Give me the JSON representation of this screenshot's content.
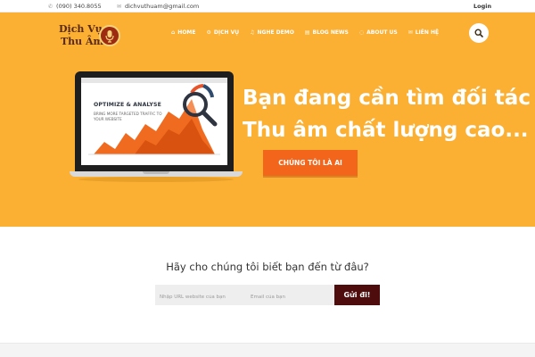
{
  "topbar": {
    "phone": "(090) 340.8055",
    "email": "dichvuthuam@gmail.com",
    "login": "Login"
  },
  "logo": {
    "line1": "Dịch Vụ",
    "line2": "Thu Âm",
    "icon": "microphone-icon"
  },
  "nav": {
    "items": [
      {
        "label": "HOME",
        "icon": "home-icon"
      },
      {
        "label": "DỊCH VỤ",
        "icon": "services-icon"
      },
      {
        "label": "NGHE DEMO",
        "icon": "headphones-icon"
      },
      {
        "label": "BLOG NEWS",
        "icon": "news-icon"
      },
      {
        "label": "ABOUT US",
        "icon": "chat-icon"
      },
      {
        "label": "LIÊN HỆ",
        "icon": "mail-icon"
      }
    ],
    "search_icon": "search-icon"
  },
  "hero": {
    "screen_title": "OPTIMIZE & ANALYSE",
    "screen_subtitle": "BRING MORE TARGETED TRAFFIC TO YOUR WEBSITE",
    "headline_line1": "Bạn đang cần tìm đối tác",
    "headline_line2": "Thu âm chất lượng cao...",
    "cta_label": "CHÚNG TÔI LÀ AI"
  },
  "form": {
    "question": "Hãy cho chúng tôi biết bạn đến từ đâu?",
    "url_placeholder": "Nhập URL website của bạn",
    "email_placeholder": "Email của bạn",
    "submit_label": "Gửi đi!"
  },
  "colors": {
    "hero_bg": "#fbb033",
    "cta": "#f2651a",
    "submit": "#4e0c0c",
    "logo_text": "#5a2a14"
  }
}
